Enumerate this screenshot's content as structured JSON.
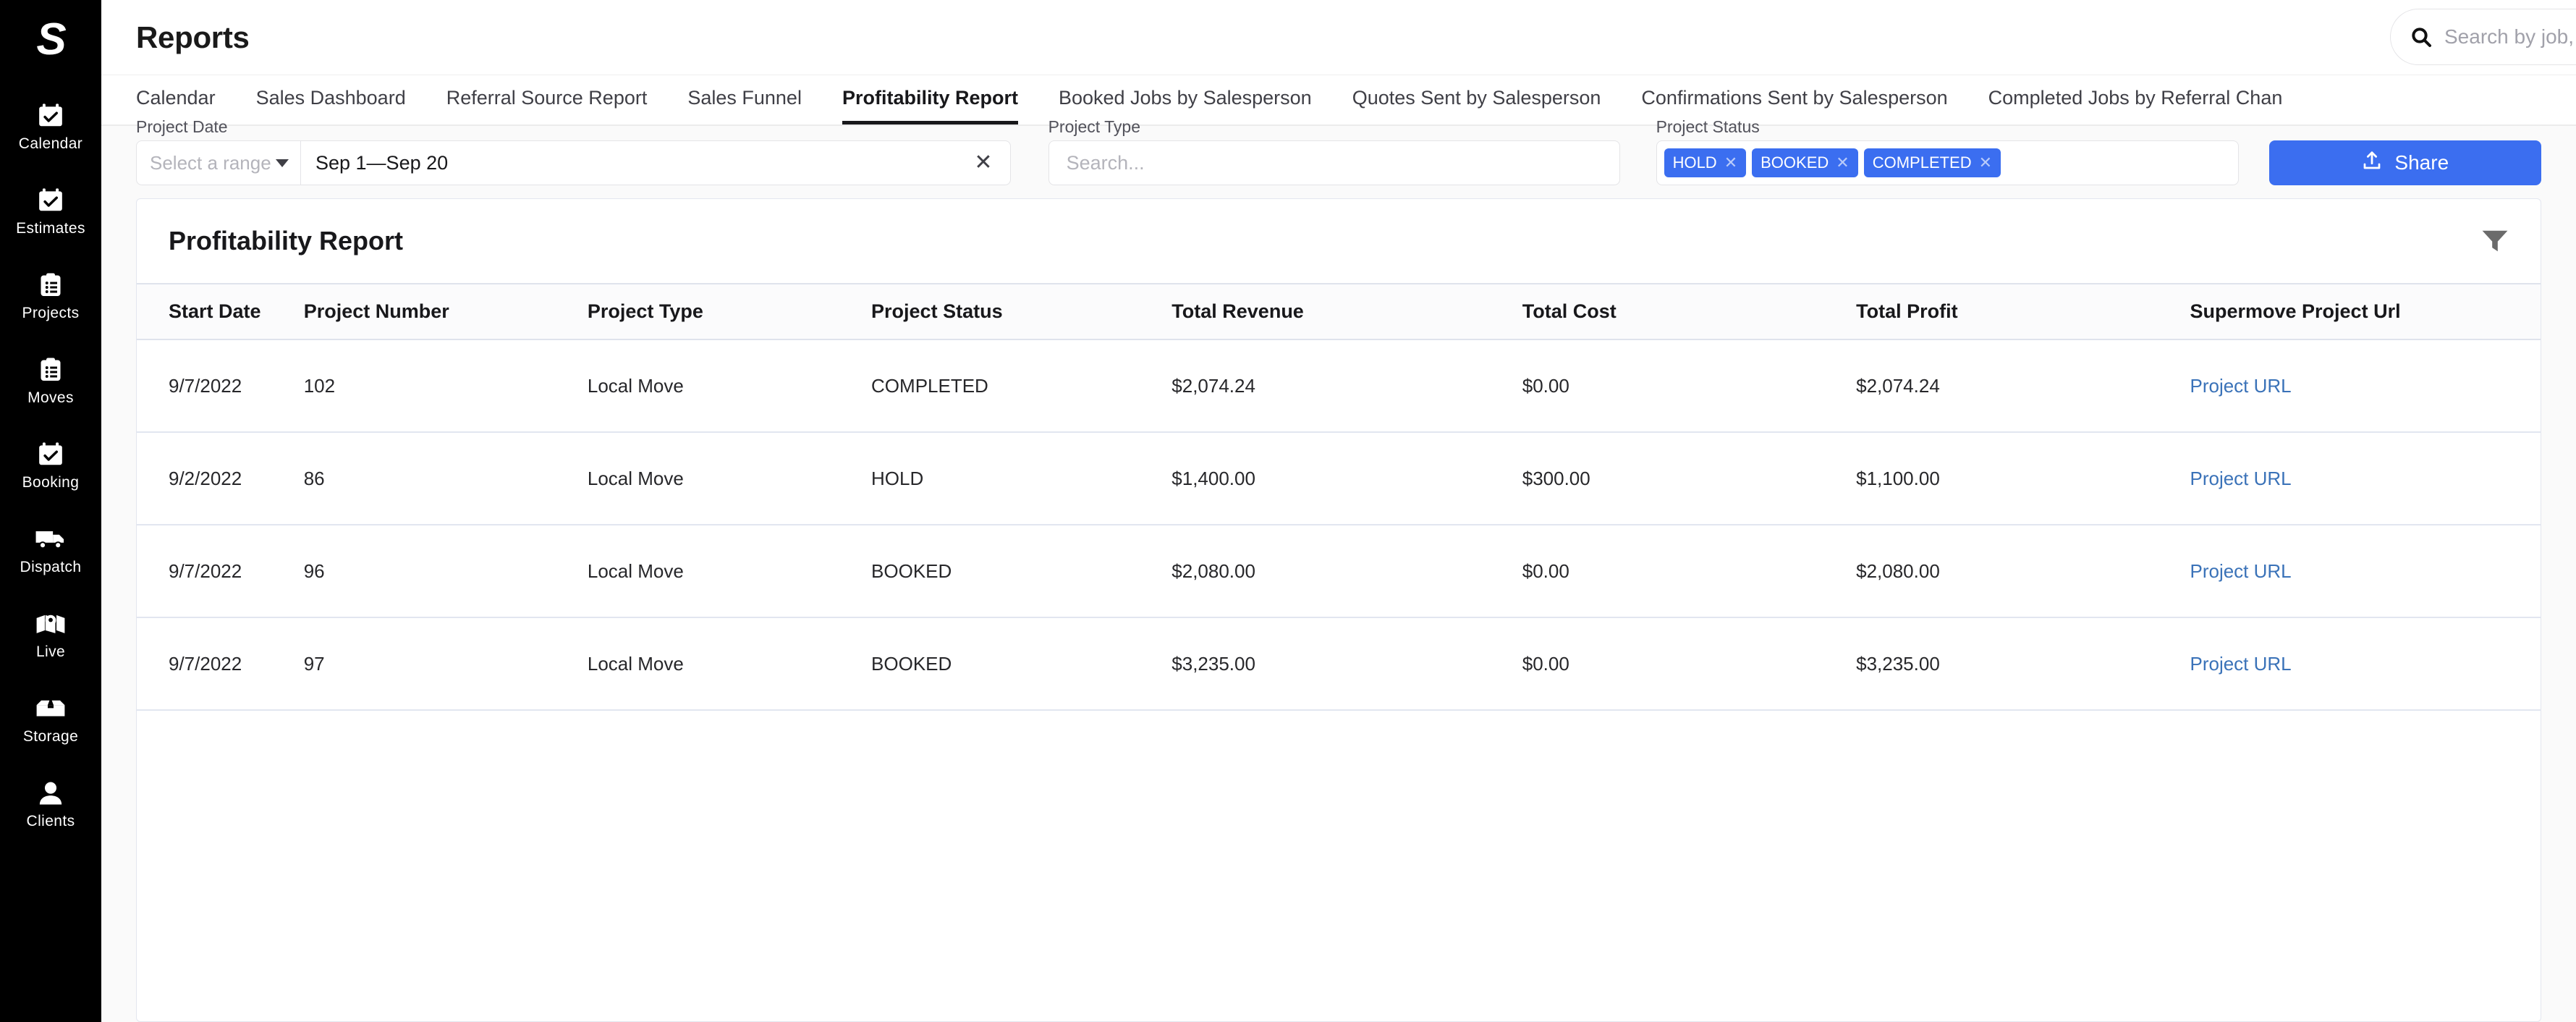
{
  "sidebar": {
    "brand": "S",
    "items": [
      {
        "label": "Calendar",
        "icon": "calendar-check-icon"
      },
      {
        "label": "Estimates",
        "icon": "calendar-check-icon"
      },
      {
        "label": "Projects",
        "icon": "clipboard-list-icon"
      },
      {
        "label": "Moves",
        "icon": "clipboard-list-icon"
      },
      {
        "label": "Booking",
        "icon": "calendar-check-icon"
      },
      {
        "label": "Dispatch",
        "icon": "truck-icon"
      },
      {
        "label": "Live",
        "icon": "map-pin-icon"
      },
      {
        "label": "Storage",
        "icon": "box-icon"
      },
      {
        "label": "Clients",
        "icon": "user-icon"
      }
    ]
  },
  "header": {
    "title": "Reports",
    "search": {
      "placeholder": "Search by job, customer,",
      "value": "",
      "icon": "search-icon"
    }
  },
  "tabs": [
    {
      "label": "Calendar",
      "active": false
    },
    {
      "label": "Sales Dashboard",
      "active": false
    },
    {
      "label": "Referral Source Report",
      "active": false
    },
    {
      "label": "Sales Funnel",
      "active": false
    },
    {
      "label": "Profitability Report",
      "active": true
    },
    {
      "label": "Booked Jobs by Salesperson",
      "active": false
    },
    {
      "label": "Quotes Sent by Salesperson",
      "active": false
    },
    {
      "label": "Confirmations Sent by Salesperson",
      "active": false
    },
    {
      "label": "Completed Jobs by Referral Chan",
      "active": false
    }
  ],
  "filters": {
    "project_date": {
      "label": "Project Date",
      "range_placeholder": "Select a range",
      "value": "Sep 1—Sep 20",
      "clear": "✕"
    },
    "project_type": {
      "label": "Project Type",
      "placeholder": "Search...",
      "value": ""
    },
    "project_status": {
      "label": "Project Status",
      "chips": [
        {
          "label": "HOLD",
          "remove": "✕"
        },
        {
          "label": "BOOKED",
          "remove": "✕"
        },
        {
          "label": "COMPLETED",
          "remove": "✕"
        }
      ]
    },
    "share_button": {
      "label": "Share",
      "icon": "share-upload-icon"
    }
  },
  "report_card": {
    "title": "Profitability Report",
    "filter_icon": "funnel-icon",
    "columns": [
      "Start Date",
      "Project Number",
      "Project Type",
      "Project Status",
      "Total Revenue",
      "Total Cost",
      "Total Profit",
      "Supermove Project Url"
    ],
    "rows": [
      {
        "start_date": "9/7/2022",
        "project_number": "102",
        "project_type": "Local Move",
        "project_status": "COMPLETED",
        "total_revenue": "$2,074.24",
        "total_cost": "$0.00",
        "total_profit": "$2,074.24",
        "project_url_label": "Project URL"
      },
      {
        "start_date": "9/2/2022",
        "project_number": "86",
        "project_type": "Local Move",
        "project_status": "HOLD",
        "total_revenue": "$1,400.00",
        "total_cost": "$300.00",
        "total_profit": "$1,100.00",
        "project_url_label": "Project URL"
      },
      {
        "start_date": "9/7/2022",
        "project_number": "96",
        "project_type": "Local Move",
        "project_status": "BOOKED",
        "total_revenue": "$2,080.00",
        "total_cost": "$0.00",
        "total_profit": "$2,080.00",
        "project_url_label": "Project URL"
      },
      {
        "start_date": "9/7/2022",
        "project_number": "97",
        "project_type": "Local Move",
        "project_status": "BOOKED",
        "total_revenue": "$3,235.00",
        "total_cost": "$0.00",
        "total_profit": "$3,235.00",
        "project_url_label": "Project URL"
      }
    ]
  },
  "colors": {
    "accent_blue": "#3b6ef0",
    "link_blue": "#3a72b8",
    "sidebar_bg": "#000000",
    "page_bg": "#fafafa",
    "active_tab": "#18181b"
  }
}
